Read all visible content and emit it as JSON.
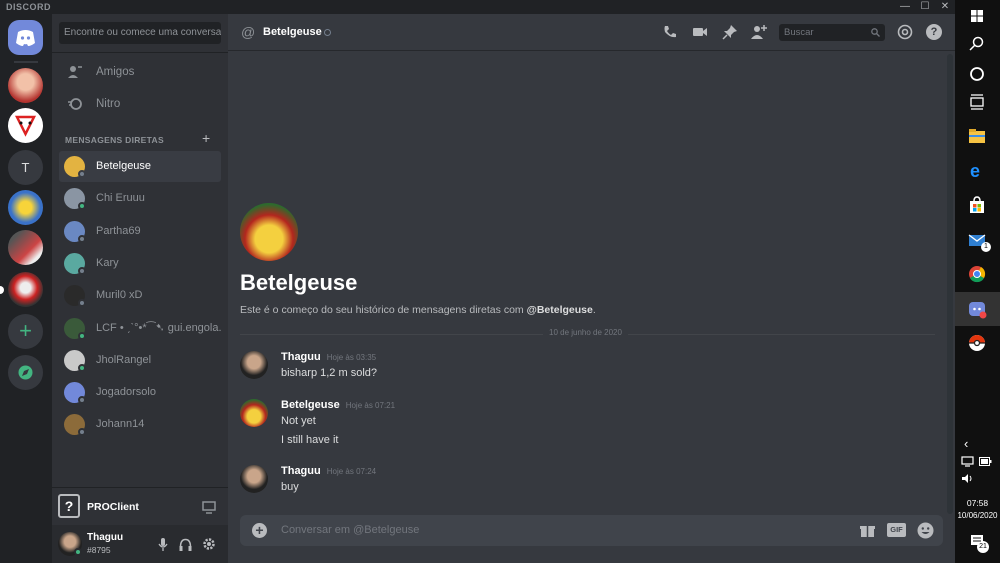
{
  "titlebar": {
    "app": "DISCORD",
    "min": "—",
    "max": "☐",
    "close": "✕"
  },
  "sidebar": {
    "search_placeholder": "Encontre ou comece uma conversa",
    "friends": "Amigos",
    "nitro": "Nitro",
    "dm_header": "MENSAGENS DIRETAS",
    "dm_add": "+",
    "dms": [
      {
        "name": "Betelgeuse",
        "status": "off",
        "color": "#e3b341",
        "active": true
      },
      {
        "name": "Chi Eruuu",
        "status": "on",
        "color": "#8a95a3"
      },
      {
        "name": "Partha69",
        "status": "off",
        "color": "#6a88c2"
      },
      {
        "name": "Kary",
        "status": "off",
        "color": "#5aa9a0"
      },
      {
        "name": "Muril0 xD",
        "status": "off",
        "color": "#2a2a2a"
      },
      {
        "name": "LCF • ˏˋ°•*⁀➷ gui.engola...",
        "status": "on",
        "color": "#3a5a3a"
      },
      {
        "name": "JholRangel",
        "status": "on",
        "color": "#c9c9c9"
      },
      {
        "name": "Jogadorsolo",
        "status": "off",
        "color": "#7289da"
      },
      {
        "name": "Johann14",
        "status": "off",
        "color": "#8c6b3a"
      }
    ],
    "proclient": "PROClient",
    "user": {
      "name": "Thaguu",
      "tag": "#8795"
    }
  },
  "guilds": {
    "server_t": "T",
    "add": "+"
  },
  "header": {
    "at": "@",
    "name": "Betelgeuse",
    "search": "Buscar",
    "help": "?"
  },
  "intro": {
    "name": "Betelgeuse",
    "text_pre": "Este é o começo do seu histórico de mensagens diretas com ",
    "text_user": "@Betelgeuse",
    "text_post": "."
  },
  "date_divider": "10 de junho de 2020",
  "messages": [
    {
      "author": "Thaguu",
      "time": "Hoje às 03:35",
      "lines": [
        "bisharp 1,2 m sold?"
      ]
    },
    {
      "author": "Betelgeuse",
      "time": "Hoje às 07:21",
      "lines": [
        "Not yet",
        "I still have it"
      ]
    },
    {
      "author": "Thaguu",
      "time": "Hoje às 07:24",
      "lines": [
        "buy"
      ]
    }
  ],
  "composer": {
    "placeholder": "Conversar em @Betelgeuse",
    "gif": "GIF"
  },
  "taskbar": {
    "mail_badge": "1",
    "time": "07:58",
    "date": "10/06/2020",
    "notif_badge": "21"
  }
}
